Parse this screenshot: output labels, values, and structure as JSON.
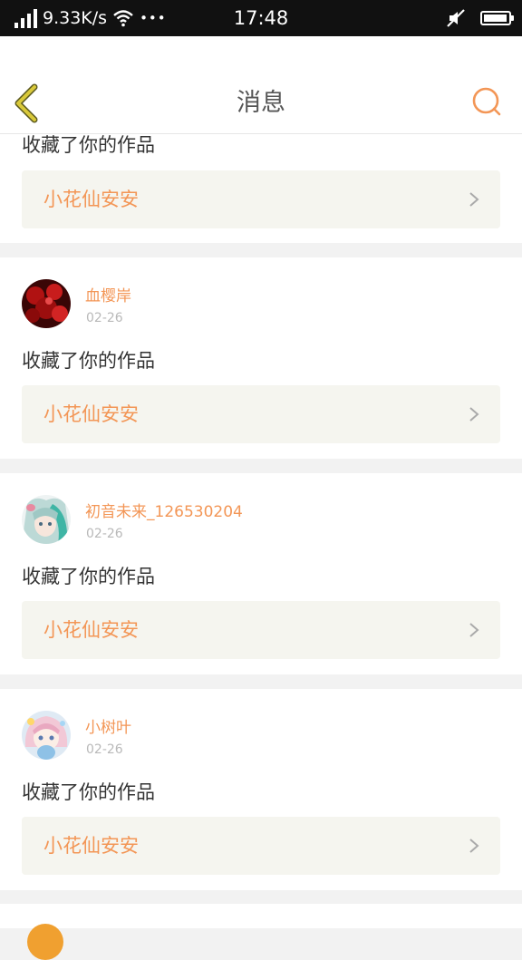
{
  "status_bar": {
    "network_speed": "9.33K/s",
    "more": "•••",
    "time": "17:48",
    "battery_level": 0.95
  },
  "nav": {
    "title": "消息",
    "back_icon": "chevron-left-icon",
    "search_icon": "search-icon"
  },
  "partial_item": {
    "action": "收藏了你的作品",
    "work_title": "小花仙安安"
  },
  "items": [
    {
      "username": "血樱岸",
      "date": "02-26",
      "action": "收藏了你的作品",
      "work_title": "小花仙安安",
      "avatar": "red-flowers-avatar"
    },
    {
      "username": "初音未来_126530204",
      "date": "02-26",
      "action": "收藏了你的作品",
      "work_title": "小花仙安安",
      "avatar": "miku-avatar"
    },
    {
      "username": "小树叶",
      "date": "02-26",
      "action": "收藏了你的作品",
      "work_title": "小花仙安安",
      "avatar": "anime-girl-avatar"
    }
  ],
  "colors": {
    "accent": "#f39656",
    "back_icon": "#d9c93a",
    "work_box": "#f5f5ef"
  }
}
